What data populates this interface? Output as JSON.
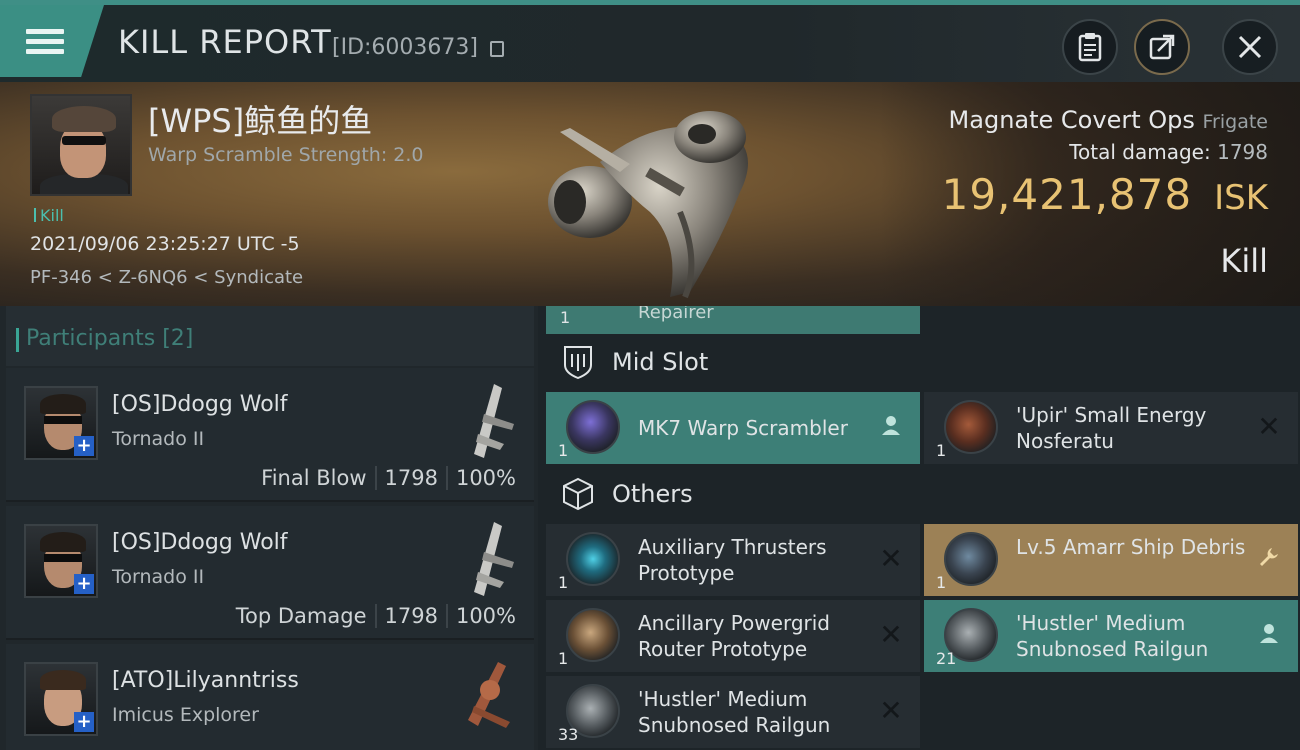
{
  "header": {
    "title": "KILL REPORT",
    "report_id": "[ID:6003673]"
  },
  "victim": {
    "name": "[WPS]鲸鱼的鱼",
    "warp_scramble": "Warp Scramble Strength: 2.0",
    "tag": "Kill",
    "time": "2021/09/06 23:25:27 UTC -5",
    "location": "PF-346 < Z-6NQ6 < Syndicate"
  },
  "ship": {
    "name": "Magnate Covert Ops",
    "class": "Frigate",
    "total_damage_label": "Total damage:",
    "total_damage": "1798",
    "isk_value": "19,421,878",
    "isk_unit": "ISK",
    "result": "Kill"
  },
  "participants": {
    "title": "Participants [2]",
    "rows": [
      {
        "name": "[OS]Ddogg Wolf",
        "ship": "Tornado II",
        "role": "Final Blow",
        "damage": "1798",
        "percent": "100%"
      },
      {
        "name": "[OS]Ddogg Wolf",
        "ship": "Tornado II",
        "role": "Top Damage",
        "damage": "1798",
        "percent": "100%"
      },
      {
        "name": "[ATO]Lilyanntriss",
        "ship": "Imicus Explorer"
      }
    ]
  },
  "fitting": {
    "repairer": {
      "label": "Repairer",
      "qty": "1"
    },
    "mid_slot_label": "Mid Slot",
    "mid_slot": [
      {
        "name": "MK7 Warp Scrambler",
        "qty": "1",
        "style": "teal",
        "action": "person-icon"
      },
      {
        "name": "'Upir' Small Energy Nosferatu",
        "qty": "1",
        "style": "dark",
        "action": "close-icon"
      }
    ],
    "others_label": "Others",
    "others": [
      {
        "name": "Auxiliary Thrusters Prototype",
        "qty": "1",
        "style": "dark",
        "action": "close-icon"
      },
      {
        "name": "Lv.5 Amarr Ship Debris",
        "qty": "1",
        "style": "gold",
        "action": "wrench-icon"
      },
      {
        "name": "Ancillary Powergrid Router Prototype",
        "qty": "1",
        "style": "dark",
        "action": "close-icon"
      },
      {
        "name": "'Hustler' Medium Snubnosed Railgun",
        "qty": "21",
        "style": "teal",
        "action": "person-icon"
      },
      {
        "name": "'Hustler' Medium Snubnosed Railgun",
        "qty": "33",
        "style": "dark",
        "action": "close-icon"
      }
    ]
  },
  "colors": {
    "accent": "#3b8f84",
    "isk": "#e8c273",
    "gold_item": "#9c8156"
  }
}
